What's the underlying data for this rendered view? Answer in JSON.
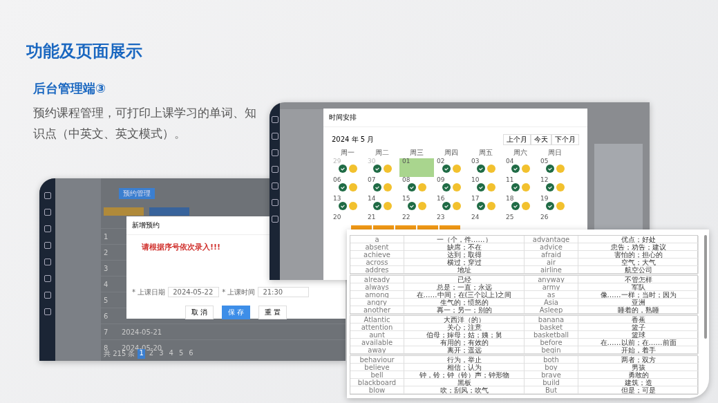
{
  "slide": {
    "title": "功能及页面展示",
    "subtitle": "后台管理端③",
    "description": "预约课程管理，可打印上课学习的单词、知识点（中英文、英文模式）。"
  },
  "booking_window": {
    "tag": "预约管理",
    "rows": [
      {
        "no": "1",
        "date": ""
      },
      {
        "no": "2",
        "date": ""
      },
      {
        "no": "3",
        "date": ""
      },
      {
        "no": "4",
        "date": ""
      },
      {
        "no": "5",
        "date": ""
      },
      {
        "no": "6",
        "date": ""
      },
      {
        "no": "7",
        "date": "2024-05-21"
      },
      {
        "no": "8",
        "date": "2024-05-20"
      }
    ],
    "total": "共 215 条",
    "pages": [
      {
        "label": "1",
        "selected": true
      },
      {
        "label": "2",
        "selected": false
      },
      {
        "label": "3",
        "selected": false
      },
      {
        "label": "4",
        "selected": false
      },
      {
        "label": "5",
        "selected": false
      },
      {
        "label": "6",
        "selected": false
      }
    ],
    "dialog": {
      "title": "新增预约",
      "warning": "请根据序号依次录入!!!",
      "fields": [
        {
          "label": "* 上课日期",
          "value": "2024-05-22"
        },
        {
          "label": "* 上课时间",
          "value": "21:30"
        }
      ],
      "buttons": [
        {
          "label": "取 消",
          "kind": "plain"
        },
        {
          "label": "保 存",
          "kind": "primary"
        },
        {
          "label": "重 置",
          "kind": "plain"
        }
      ]
    }
  },
  "schedule_window": {
    "dialog_title": "时间安排",
    "month": "2024 年 5 月",
    "nav_buttons": [
      "上个月",
      "今天",
      "下个月"
    ],
    "weekdays": [
      "周一",
      "周二",
      "周三",
      "周四",
      "周五",
      "周六",
      "周日"
    ],
    "weeks": [
      [
        {
          "label": "29",
          "muted": true,
          "selected": false,
          "dots": true
        },
        {
          "label": "30",
          "muted": true,
          "selected": false,
          "dots": true
        },
        {
          "label": "01",
          "muted": false,
          "selected": true,
          "dots": false
        },
        {
          "label": "02",
          "muted": false,
          "selected": false,
          "dots": true
        },
        {
          "label": "03",
          "muted": false,
          "selected": false,
          "dots": true
        },
        {
          "label": "04",
          "muted": false,
          "selected": false,
          "dots": true
        },
        {
          "label": "05",
          "muted": false,
          "selected": false,
          "dots": true
        }
      ],
      [
        {
          "label": "06",
          "muted": false,
          "selected": false,
          "dots": true
        },
        {
          "label": "07",
          "muted": false,
          "selected": false,
          "dots": true
        },
        {
          "label": "08",
          "muted": false,
          "selected": false,
          "dots": true
        },
        {
          "label": "09",
          "muted": false,
          "selected": false,
          "dots": true
        },
        {
          "label": "10",
          "muted": false,
          "selected": false,
          "dots": true
        },
        {
          "label": "11",
          "muted": false,
          "selected": false,
          "dots": true
        },
        {
          "label": "12",
          "muted": false,
          "selected": false,
          "dots": true
        }
      ],
      [
        {
          "label": "13",
          "muted": false,
          "selected": false,
          "dots": true
        },
        {
          "label": "14",
          "muted": false,
          "selected": false,
          "dots": true
        },
        {
          "label": "15",
          "muted": false,
          "selected": false,
          "dots": true
        },
        {
          "label": "16",
          "muted": false,
          "selected": false,
          "dots": true
        },
        {
          "label": "17",
          "muted": false,
          "selected": false,
          "dots": true
        },
        {
          "label": "18",
          "muted": false,
          "selected": false,
          "dots": true
        },
        {
          "label": "19",
          "muted": false,
          "selected": false,
          "dots": true
        }
      ],
      [
        {
          "label": "20",
          "muted": false,
          "selected": false,
          "dots": false
        },
        {
          "label": "21",
          "muted": false,
          "selected": false,
          "dots": false
        },
        {
          "label": "22",
          "muted": false,
          "selected": false,
          "dots": false
        },
        {
          "label": "23",
          "muted": false,
          "selected": false,
          "dots": false
        },
        {
          "label": "24",
          "muted": false,
          "selected": false,
          "dots": false
        },
        {
          "label": "25",
          "muted": false,
          "selected": false,
          "dots": false
        },
        {
          "label": "26",
          "muted": false,
          "selected": false,
          "dots": false
        }
      ]
    ]
  },
  "word_table": {
    "groups": [
      [
        [
          "a",
          "一（个，件……）",
          "advantage",
          "优点；好处"
        ],
        [
          "absent",
          "缺席；不在",
          "advice",
          "忠告；劝告；建议"
        ],
        [
          "achieve",
          "达到；取得",
          "afraid",
          "害怕的；担心的"
        ],
        [
          "across",
          "横过；穿过",
          "air",
          "空气；大气"
        ],
        [
          "addres",
          "地址",
          "airline",
          "航空公司"
        ]
      ],
      [
        [
          "already",
          "已经",
          "anyway",
          "不管怎样"
        ],
        [
          "always",
          "总是；一直；永远",
          "army",
          "军队"
        ],
        [
          "among",
          "在……中间；在(三个以上)之间",
          "as",
          "像……一样；当时；因为"
        ],
        [
          "angry",
          "生气的；愤怒的",
          "Asia",
          "亚洲"
        ],
        [
          "another",
          "再一；另一；别的",
          "Asleep",
          "睡着的，熟睡"
        ]
      ],
      [
        [
          "Atlantic",
          "大西洋（的）",
          "banana",
          "香蕉"
        ],
        [
          "attention",
          "关心；注意",
          "basket",
          "篮子"
        ],
        [
          "aunt",
          "伯母；婶母；姑；姨；舅",
          "basketball",
          "篮球"
        ],
        [
          "available",
          "有用的；有效的",
          "before",
          "在……以前；在……前面"
        ],
        [
          "away",
          "离开；遥远",
          "begin",
          "开始，着手"
        ]
      ],
      [
        [
          "behaviour",
          "行为，举止",
          "both",
          "两者；双方"
        ],
        [
          "believe",
          "相信；认为",
          "boy",
          "男孩"
        ],
        [
          "bell",
          "钟，铃；钟（铃）声；钟形物",
          "brave",
          "勇敢的"
        ],
        [
          "blackboard",
          "黑板",
          "build",
          "建筑；造"
        ],
        [
          "blow",
          "吹；刮风；吹气",
          "But",
          "但是；可是"
        ]
      ]
    ]
  }
}
